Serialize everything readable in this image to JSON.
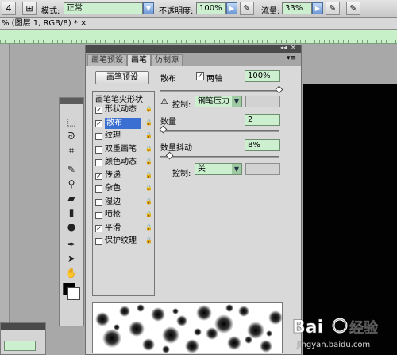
{
  "options_bar": {
    "mode_label": "模式:",
    "mode_value": "正常",
    "opacity_label": "不透明度:",
    "opacity_value": "100%",
    "flow_label": "流量:",
    "flow_value": "33%"
  },
  "document": {
    "tab_title": "% (图层 1, RGB/8) * ×"
  },
  "panel": {
    "tabs": [
      "画笔预设",
      "画笔",
      "仿制源"
    ],
    "active_tab": 1,
    "preset_button": "画笔预设",
    "list_header": "画笔笔尖形状",
    "items": [
      {
        "label": "形状动态",
        "checked": true
      },
      {
        "label": "散布",
        "checked": true,
        "selected": true
      },
      {
        "label": "纹理",
        "checked": false
      },
      {
        "label": "双重画笔",
        "checked": false
      },
      {
        "label": "颜色动态",
        "checked": false
      },
      {
        "label": "传递",
        "checked": true
      },
      {
        "label": "杂色",
        "checked": false
      },
      {
        "label": "湿边",
        "checked": false
      },
      {
        "label": "喷枪",
        "checked": false
      },
      {
        "label": "平滑",
        "checked": true
      },
      {
        "label": "保护纹理",
        "checked": false
      }
    ],
    "scatter": {
      "label": "散布",
      "both_axes_label": "两轴",
      "both_axes_checked": true,
      "value": "100%",
      "level": 1.0
    },
    "control1": {
      "label": "控制:",
      "value": "钢笔压力"
    },
    "count": {
      "label": "数量",
      "value": "2",
      "level": 0.0
    },
    "count_jitter": {
      "label": "数量抖动",
      "value": "8%",
      "level": 0.08
    },
    "control2": {
      "label": "控制:",
      "value": "关"
    }
  },
  "watermark": {
    "text": "Bai 经验",
    "sub": "jingyan.baidu.com"
  },
  "colors": {
    "field_green": "#ccefd0",
    "selection_blue": "#3b6fd1",
    "canvas": "#020202"
  }
}
